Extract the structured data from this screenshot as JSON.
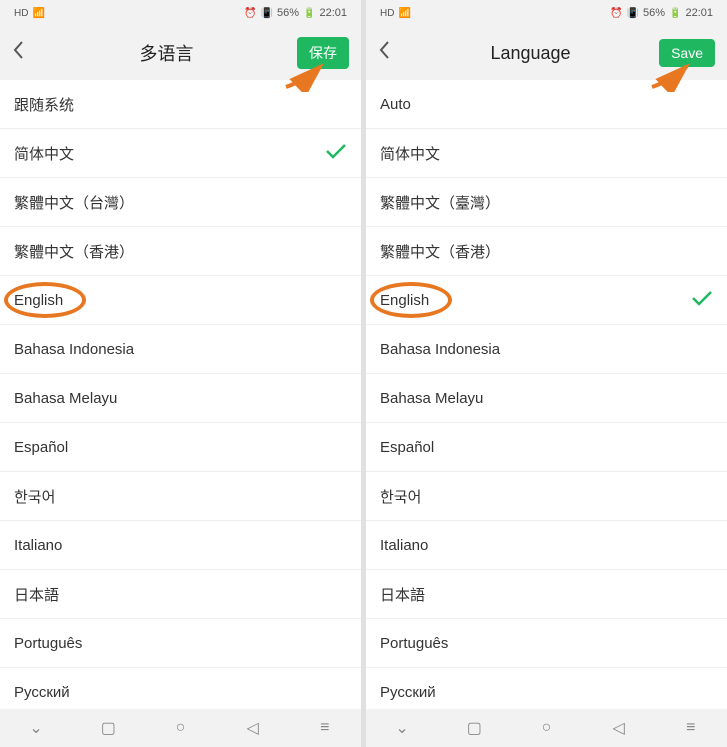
{
  "status": {
    "hd": "HD",
    "signal": "⁴ᴳ",
    "alarm": "⏰",
    "vibrate": "📳",
    "battery_pct": "56%",
    "time": "22:01"
  },
  "screens": [
    {
      "title": "多语言",
      "save_label": "保存",
      "items": [
        {
          "label": "跟随系统",
          "checked": false,
          "highlighted": false
        },
        {
          "label": "简体中文",
          "checked": true,
          "highlighted": false
        },
        {
          "label": "繁體中文（台灣）",
          "checked": false,
          "highlighted": false
        },
        {
          "label": "繁體中文（香港）",
          "checked": false,
          "highlighted": false
        },
        {
          "label": "English",
          "checked": false,
          "highlighted": true
        },
        {
          "label": "Bahasa Indonesia",
          "checked": false,
          "highlighted": false
        },
        {
          "label": "Bahasa Melayu",
          "checked": false,
          "highlighted": false
        },
        {
          "label": "Español",
          "checked": false,
          "highlighted": false
        },
        {
          "label": "한국어",
          "checked": false,
          "highlighted": false
        },
        {
          "label": "Italiano",
          "checked": false,
          "highlighted": false
        },
        {
          "label": "日本語",
          "checked": false,
          "highlighted": false
        },
        {
          "label": "Português",
          "checked": false,
          "highlighted": false
        },
        {
          "label": "Русский",
          "checked": false,
          "highlighted": false
        }
      ]
    },
    {
      "title": "Language",
      "save_label": "Save",
      "items": [
        {
          "label": "Auto",
          "checked": false,
          "highlighted": false
        },
        {
          "label": "简体中文",
          "checked": false,
          "highlighted": false
        },
        {
          "label": "繁體中文（臺灣）",
          "checked": false,
          "highlighted": false
        },
        {
          "label": "繁體中文（香港）",
          "checked": false,
          "highlighted": false
        },
        {
          "label": "English",
          "checked": true,
          "highlighted": true
        },
        {
          "label": "Bahasa Indonesia",
          "checked": false,
          "highlighted": false
        },
        {
          "label": "Bahasa Melayu",
          "checked": false,
          "highlighted": false
        },
        {
          "label": "Español",
          "checked": false,
          "highlighted": false
        },
        {
          "label": "한국어",
          "checked": false,
          "highlighted": false
        },
        {
          "label": "Italiano",
          "checked": false,
          "highlighted": false
        },
        {
          "label": "日本語",
          "checked": false,
          "highlighted": false
        },
        {
          "label": "Português",
          "checked": false,
          "highlighted": false
        },
        {
          "label": "Русский",
          "checked": false,
          "highlighted": false
        }
      ]
    }
  ],
  "colors": {
    "accent": "#1fb861",
    "highlight": "#e87722"
  }
}
